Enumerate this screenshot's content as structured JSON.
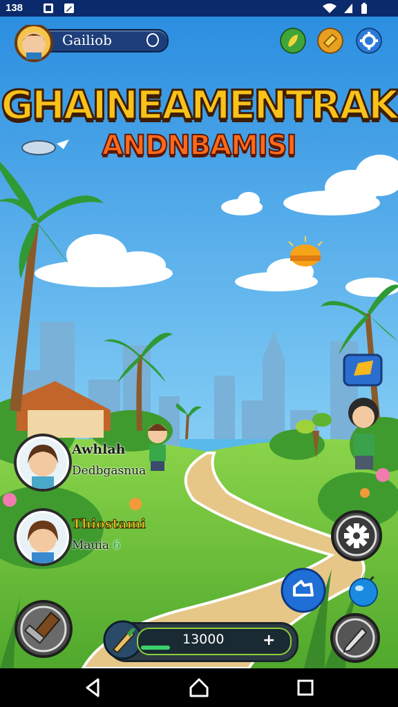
{
  "status_bar": {
    "time": "138",
    "icons": [
      "image-icon",
      "pen-icon",
      "wifi-icon",
      "signal-icon",
      "battery-icon"
    ]
  },
  "header": {
    "player_name": "Gailiob",
    "icons": [
      "leaf-icon",
      "coin-icon",
      "gear-icon"
    ]
  },
  "title": {
    "main": "GHAINEAMENTRAK",
    "subtitle": "ANDNBAMISI"
  },
  "characters": [
    {
      "name": "Awhlah",
      "subtitle": "Dedbgasnua"
    },
    {
      "name": "Thiostami",
      "subtitle": "Mauia",
      "count": "6"
    }
  ],
  "resource_bar": {
    "value": "13000",
    "plus_label": "+",
    "fill_fraction": 0.2
  },
  "colors": {
    "sky_top": "#2b8ee0",
    "sky_bottom": "#bfe6fb",
    "grass": "#6cc23a",
    "path": "#e6c787",
    "title_yellow": "#f9c21a",
    "subtitle_orange": "#ff6a1a",
    "status_bar": "#0b2a6b"
  },
  "nav": [
    "back-icon",
    "home-icon",
    "recent-apps-icon"
  ]
}
